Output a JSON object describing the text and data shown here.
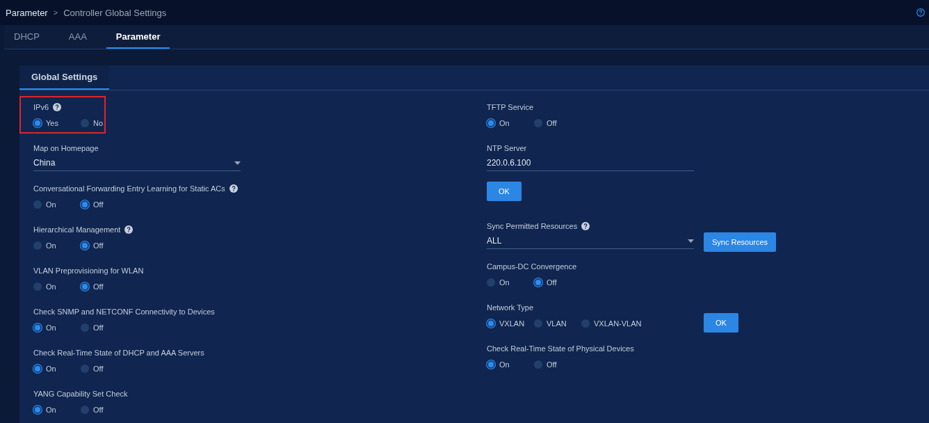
{
  "breadcrumb": {
    "items": [
      "Parameter",
      "Controller Global Settings"
    ],
    "separator": ">"
  },
  "tabs": [
    {
      "label": "DHCP",
      "selected": false
    },
    {
      "label": "AAA",
      "selected": false
    },
    {
      "label": "Parameter",
      "selected": true
    }
  ],
  "section_tabs": [
    {
      "label": "Global Settings",
      "selected": true
    }
  ],
  "left_fields": [
    {
      "kind": "radio",
      "label": "IPv6",
      "help": true,
      "highlighted": true,
      "options": [
        {
          "label": "Yes",
          "selected": true
        },
        {
          "label": "No",
          "selected": false
        }
      ]
    },
    {
      "kind": "select",
      "label": "Map on Homepage",
      "value": "China"
    },
    {
      "kind": "radio",
      "label": "Conversational Forwarding Entry Learning for Static ACs",
      "help": true,
      "options": [
        {
          "label": "On",
          "selected": false
        },
        {
          "label": "Off",
          "selected": true
        }
      ]
    },
    {
      "kind": "radio",
      "label": "Hierarchical Management",
      "help": true,
      "options": [
        {
          "label": "On",
          "selected": false
        },
        {
          "label": "Off",
          "selected": true
        }
      ]
    },
    {
      "kind": "radio",
      "label": "VLAN Preprovisioning for WLAN",
      "options": [
        {
          "label": "On",
          "selected": false
        },
        {
          "label": "Off",
          "selected": true
        }
      ]
    },
    {
      "kind": "radio",
      "label": "Check SNMP and NETCONF Connectivity to Devices",
      "options": [
        {
          "label": "On",
          "selected": true
        },
        {
          "label": "Off",
          "selected": false
        }
      ]
    },
    {
      "kind": "radio",
      "label": "Check Real-Time State of DHCP and AAA Servers",
      "options": [
        {
          "label": "On",
          "selected": true
        },
        {
          "label": "Off",
          "selected": false
        }
      ]
    },
    {
      "kind": "radio",
      "label": "YANG Capability Set Check",
      "options": [
        {
          "label": "On",
          "selected": true
        },
        {
          "label": "Off",
          "selected": false
        }
      ]
    }
  ],
  "right_fields": [
    {
      "kind": "radio",
      "label": "TFTP Service",
      "options": [
        {
          "label": "On",
          "selected": true
        },
        {
          "label": "Off",
          "selected": false
        }
      ]
    },
    {
      "kind": "input",
      "label": "NTP Server",
      "value": "220.0.6.100"
    },
    {
      "kind": "button",
      "label": "OK"
    },
    {
      "kind": "select",
      "label": "Sync Permitted Resources",
      "help": true,
      "value": "ALL",
      "action": "Sync Resources"
    },
    {
      "kind": "radio",
      "label": "Campus-DC Convergence",
      "options": [
        {
          "label": "On",
          "selected": false
        },
        {
          "label": "Off",
          "selected": true
        }
      ]
    },
    {
      "kind": "radio",
      "label": "Network Type",
      "action": "OK",
      "options": [
        {
          "label": "VXLAN",
          "selected": true
        },
        {
          "label": "VLAN",
          "selected": false
        },
        {
          "label": "VXLAN-VLAN",
          "selected": false
        }
      ]
    },
    {
      "kind": "radio",
      "label": "Check Real-Time State of Physical Devices",
      "options": [
        {
          "label": "On",
          "selected": true
        },
        {
          "label": "Off",
          "selected": false
        }
      ]
    }
  ]
}
